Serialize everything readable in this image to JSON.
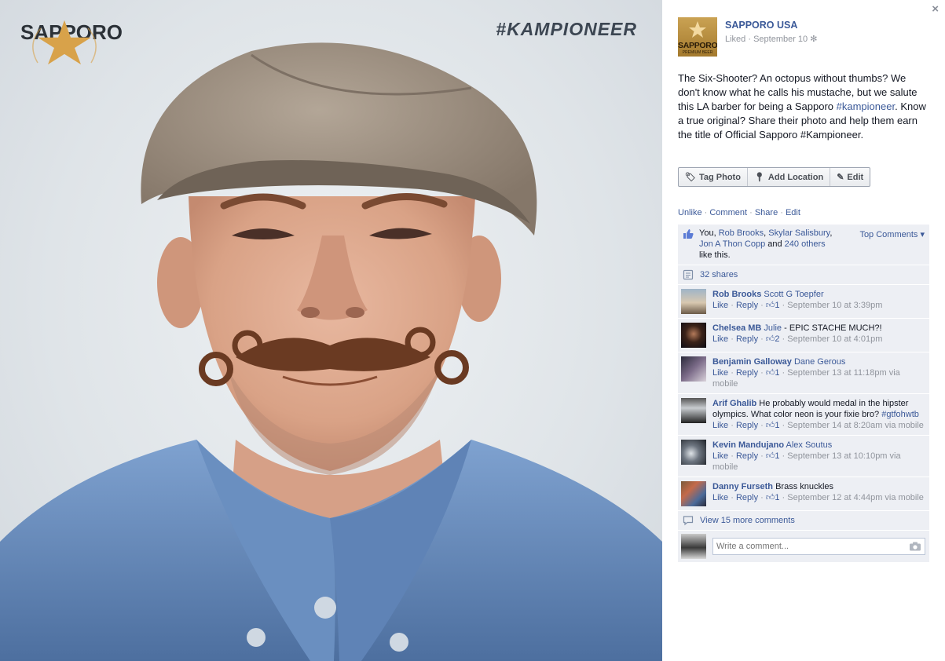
{
  "photo": {
    "brand_name": "SAPPORO",
    "hashtag": "#KAMPIONEER",
    "colors": {
      "backdrop": "#e1e6ea",
      "star": "#d8a24a",
      "brand_text": "#2b3137",
      "cap": "#a6988a",
      "shirt": "#6b8fc4",
      "skin": "#dca98f",
      "mustache": "#6a3a22"
    }
  },
  "post": {
    "close_label": "×",
    "page_name": "SAPPORO USA",
    "logo_text": "SAPPORO",
    "logo_sub": "PREMIUM BEER",
    "meta": "Liked · September 10",
    "caption_parts": {
      "p1": "The Six-Shooter? An octopus without thumbs? We don't know what he calls his mustache, but we salute this LA barber for being a Sapporo ",
      "tag1": "#kampioneer",
      "p2": ". Know a true original? Share their photo and help them earn the title of Official Sapporo #Kampioneer."
    },
    "actions": {
      "tag_photo": "Tag Photo",
      "add_location": "Add Location",
      "edit": "Edit"
    },
    "links": {
      "unlike": "Unlike",
      "comment": "Comment",
      "share": "Share",
      "edit": "Edit",
      "sep": " · "
    },
    "likes": {
      "you": "You, ",
      "names": [
        "Rob Brooks",
        "Skylar Salisbury",
        "Jon A Thon Copp"
      ],
      "comma": ", ",
      "and": " and ",
      "others": "240 others",
      "tail": "like this.",
      "top_comments": "Top Comments ▾"
    },
    "shares": "32 shares",
    "comments": [
      {
        "author": "Rob Brooks",
        "target": "Scott G Toepfer",
        "text": "",
        "like": "Like",
        "reply": "Reply",
        "likes": "1",
        "time": " · September 10 at 3:39pm",
        "via": ""
      },
      {
        "author": "Chelsea MB",
        "target": "Julie",
        "text": " - EPIC STACHE MUCH?!",
        "like": "Like",
        "reply": "Reply",
        "likes": "2",
        "time": " · September 10 at 4:01pm",
        "via": ""
      },
      {
        "author": "Benjamin Galloway",
        "target": "Dane Gerous",
        "text": "",
        "like": "Like",
        "reply": "Reply",
        "likes": "1",
        "time": " · September 13 at 11:18pm via mobile",
        "via": ""
      },
      {
        "author": "Arif Ghalib",
        "target": "",
        "text": " He probably would medal in the hipster olympics. What color neon is your fixie bro? ",
        "tag": "#gtfohwtb",
        "like": "Like",
        "reply": "Reply",
        "likes": "1",
        "time": " · September 14 at 8:20am via mobile",
        "via": ""
      },
      {
        "author": "Kevin Mandujano",
        "target": "Alex Soutus",
        "text": "",
        "like": "Like",
        "reply": "Reply",
        "likes": "1",
        "time": " · September 13 at 10:10pm via mobile",
        "via": ""
      },
      {
        "author": "Danny Furseth",
        "target": "",
        "text": " Brass knuckles",
        "like": "Like",
        "reply": "Reply",
        "likes": "1",
        "time": " · September 12 at 4:44pm via mobile",
        "via": ""
      }
    ],
    "more_comments": "View 15 more comments",
    "comment_placeholder": "Write a comment...",
    "accent": "#3b5998"
  }
}
